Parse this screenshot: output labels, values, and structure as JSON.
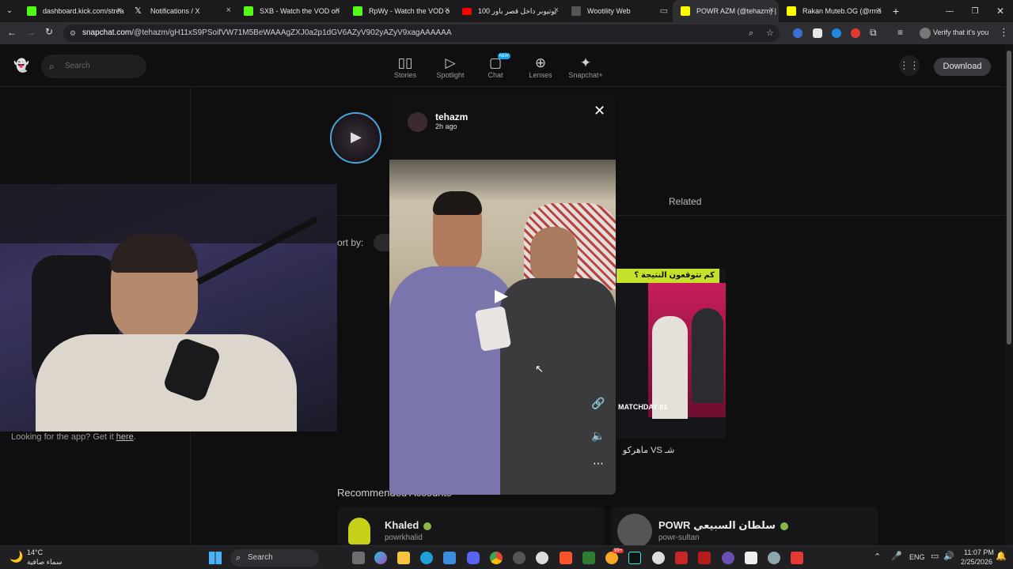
{
  "browser": {
    "tabs": [
      {
        "title": "dashboard.kick.com/strea",
        "favicon_color": "#53fc18"
      },
      {
        "title": "Notifications / X",
        "favicon_color": "#ffffff"
      },
      {
        "title": "SXB - Watch the VOD on",
        "favicon_color": "#53fc18"
      },
      {
        "title": "RpWy - Watch the VOD o",
        "favicon_color": "#53fc18"
      },
      {
        "title": "100 يوتيوبر داخل قصر باور",
        "favicon_color": "#ff0000"
      },
      {
        "title": "Wootility Web",
        "favicon_color": "#888888"
      },
      {
        "title": "POWR AZM (@tehazm) |",
        "favicon_color": "#fffc00"
      },
      {
        "title": "Rakan Muteb.OG (@rms",
        "favicon_color": "#fffc00"
      }
    ],
    "url_host": "snapchat.com",
    "url_path": "/@tehazm/gH11xS9PSoifVW71M5BeWAAAgZXJ0a2p1dGV6AZyV902yAZyV9xagAAAAAA",
    "verify_label": "Verify that it's you"
  },
  "snap": {
    "search_placeholder": "Search",
    "nav": [
      {
        "label": "Stories",
        "icon": "stories-icon"
      },
      {
        "label": "Spotlight",
        "icon": "spotlight-icon"
      },
      {
        "label": "Chat",
        "icon": "chat-icon",
        "badge": "NEW"
      },
      {
        "label": "Lenses",
        "icon": "lenses-icon"
      },
      {
        "label": "Snapchat+",
        "icon": "snapchat-plus-icon"
      }
    ],
    "download_label": "Download"
  },
  "page": {
    "sort_label": "ort by:",
    "related_label": "Related",
    "looking_text": "Looking for the app? Get it ",
    "looking_link": "here",
    "looking_end": ".",
    "recommended_heading": "Recommended Accounts",
    "thumb_caption": "ماهركو VS شـ",
    "thumb_banner": "كم تتوقعون النتيجة ؟",
    "thumb_sub": "MATCHDAY 01",
    "accounts": [
      {
        "name": "Khaled",
        "handle": "powrkhalid"
      },
      {
        "name": "POWR سلطان السبيعي",
        "handle": "powr-sultan"
      }
    ]
  },
  "story": {
    "username": "tehazm",
    "time": "2h ago"
  },
  "taskbar": {
    "weather_temp": "14°C",
    "weather_text": "سماء صافية",
    "search_label": "Search",
    "lang": "ENG",
    "time": "11:07 PM",
    "date": "2/25/2026",
    "badge_count": "99+"
  },
  "colors": {
    "snap_yellow": "#fffc00",
    "verified_green": "#8ab74a"
  }
}
